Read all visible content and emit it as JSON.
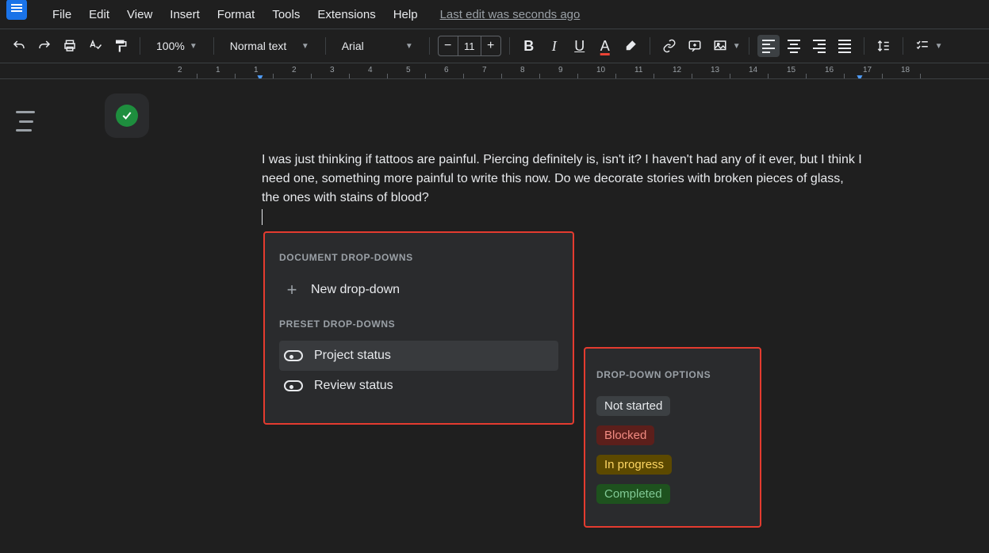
{
  "menubar": {
    "items": [
      "File",
      "Edit",
      "View",
      "Insert",
      "Format",
      "Tools",
      "Extensions",
      "Help"
    ],
    "last_edit": "Last edit was seconds ago"
  },
  "toolbar": {
    "zoom": "100%",
    "style": "Normal text",
    "font": "Arial",
    "font_size": "11"
  },
  "ruler": {
    "numbers": [
      "2",
      "1",
      "1",
      "2",
      "3",
      "4",
      "5",
      "6",
      "7",
      "8",
      "9",
      "10",
      "11",
      "12",
      "13",
      "14",
      "15",
      "16",
      "17",
      "18"
    ]
  },
  "document": {
    "paragraph": "I was just thinking if tattoos are painful. Piercing definitely is, isn't it? I haven't had any of it ever, but I think I need one, something more painful to write this now. Do we decorate stories with broken pieces of glass, the ones with stains of blood?"
  },
  "dropdown_panel": {
    "section1_title": "DOCUMENT DROP-DOWNS",
    "new_dropdown": "New drop-down",
    "section2_title": "PRESET DROP-DOWNS",
    "presets": [
      "Project status",
      "Review status"
    ]
  },
  "options_panel": {
    "title": "DROP-DOWN OPTIONS",
    "options": [
      {
        "label": "Not started",
        "klass": "gray"
      },
      {
        "label": "Blocked",
        "klass": "red"
      },
      {
        "label": "In progress",
        "klass": "yellow"
      },
      {
        "label": "Completed",
        "klass": "green"
      }
    ]
  }
}
